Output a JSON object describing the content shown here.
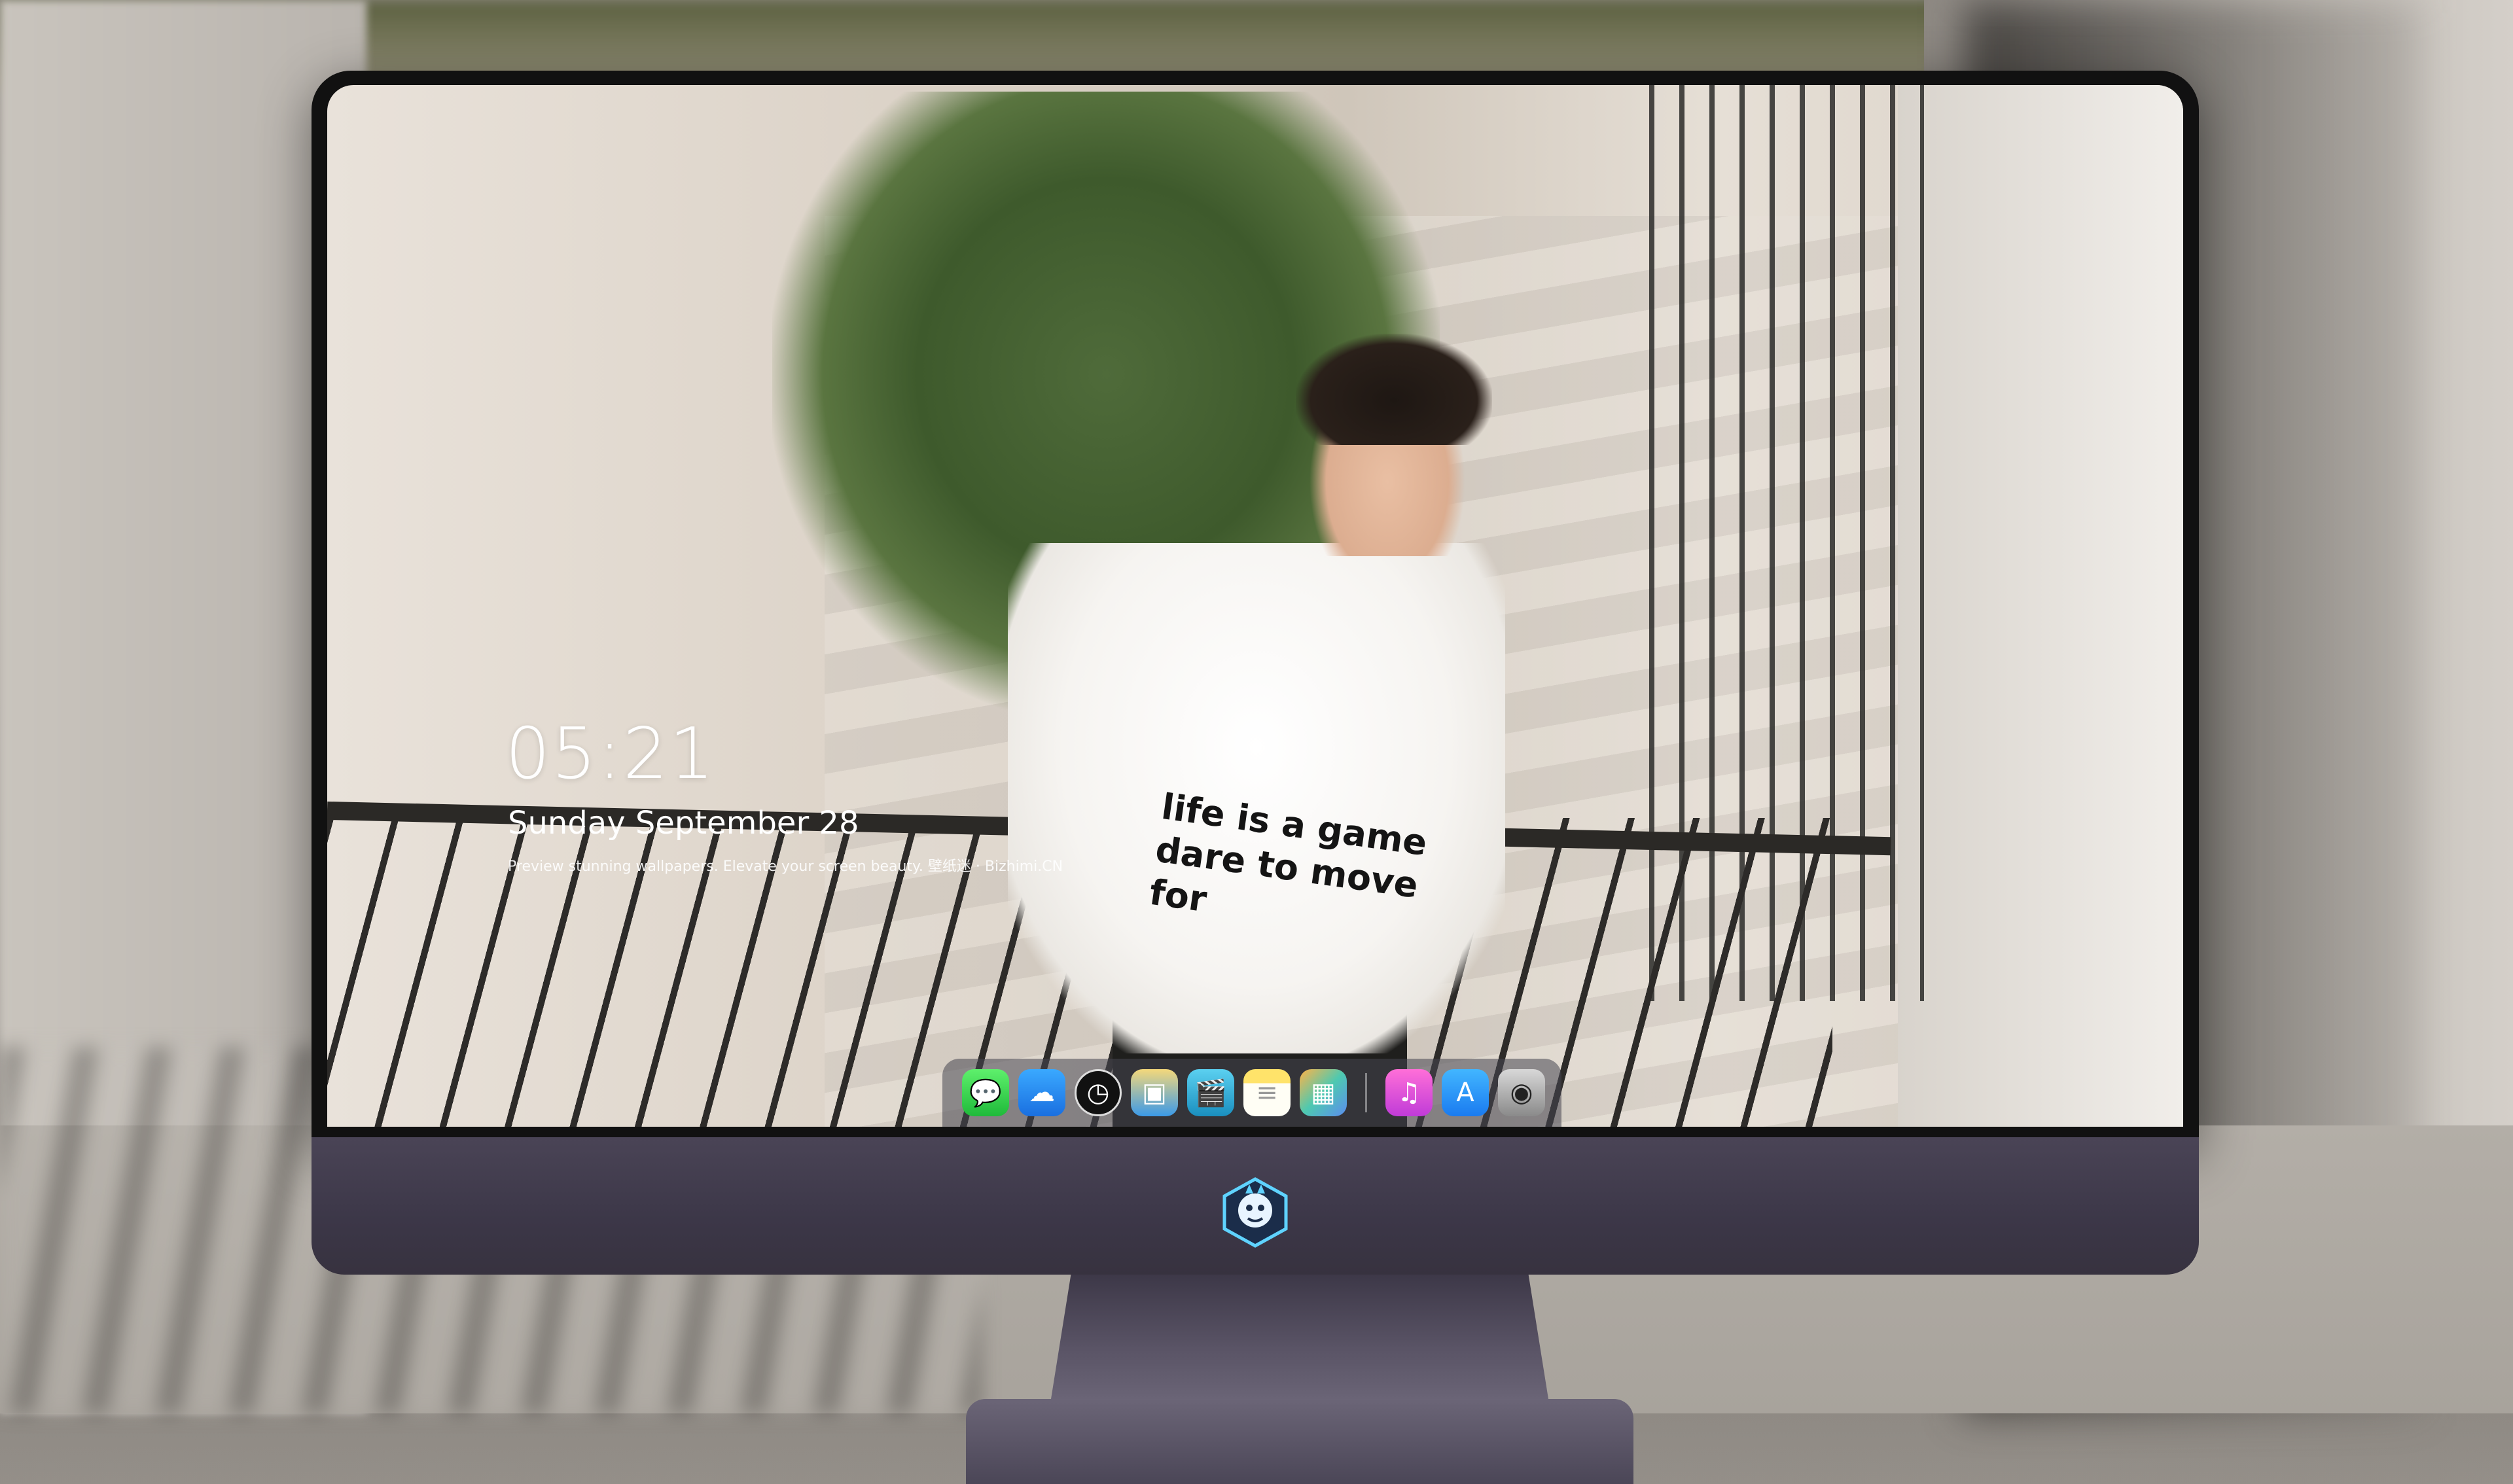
{
  "lockscreen": {
    "time": "05:21",
    "date": "Sunday September  28",
    "tagline": "Preview stunning wallpapers. Elevate your screen beauty. 壁纸迷 · Bizhimi.CN"
  },
  "wallpaper": {
    "shirt_line1": "life is a game",
    "shirt_line2": "dare to move for"
  },
  "dock": {
    "apps": [
      {
        "name": "messages",
        "glyph": "💬"
      },
      {
        "name": "weather",
        "glyph": "☁"
      },
      {
        "name": "clock",
        "glyph": "◷"
      },
      {
        "name": "preview",
        "glyph": "▣"
      },
      {
        "name": "claquette",
        "glyph": "🎬"
      },
      {
        "name": "notes",
        "glyph": "≡"
      },
      {
        "name": "photos",
        "glyph": "▦"
      }
    ],
    "apps_right": [
      {
        "name": "music",
        "glyph": "♫"
      },
      {
        "name": "app-store",
        "glyph": "A"
      },
      {
        "name": "camera",
        "glyph": "◉"
      }
    ]
  },
  "colors": {
    "bezel": "#111111",
    "chin": "#3c3748",
    "dock": "#46464f",
    "clock_text": "#ffffff"
  },
  "logo": {
    "icon": "dragon-mascot-icon",
    "color": "#5fd3ff"
  }
}
